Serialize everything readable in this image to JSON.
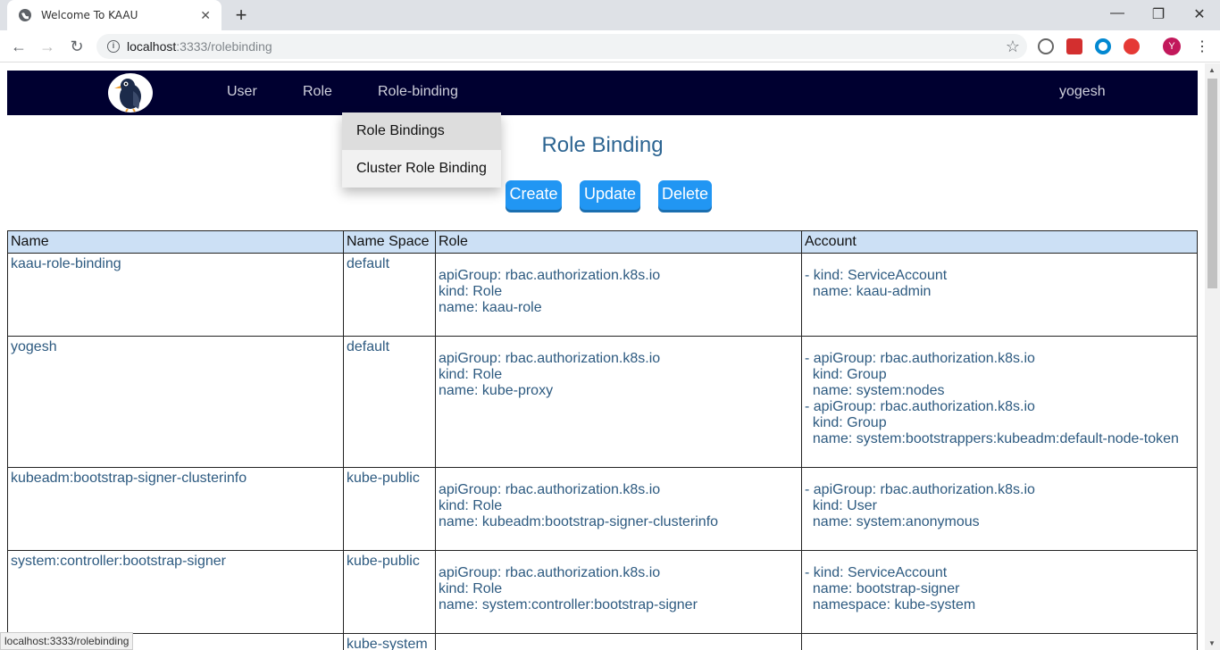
{
  "browser": {
    "tab_title": "Welcome To KAAU",
    "tab_close": "✕",
    "new_tab": "+",
    "url_host": "localhost",
    "url_rest": ":3333/rolebinding",
    "status_url": "localhost:3333/rolebinding",
    "avatar_letter": "Y"
  },
  "nav": {
    "links": [
      "User",
      "Role",
      "Role-binding"
    ],
    "user": "yogesh"
  },
  "dropdown": {
    "items": [
      "Role Bindings",
      "Cluster Role Binding"
    ]
  },
  "page": {
    "title": "Role Binding",
    "buttons": [
      "Create",
      "Update",
      "Delete"
    ]
  },
  "table": {
    "headers": [
      "Name",
      "Name Space",
      "Role",
      "Account"
    ],
    "rows": [
      {
        "name": "kaau-role-binding",
        "namespace": "default",
        "role": "apiGroup: rbac.authorization.k8s.io\nkind: Role\nname: kaau-role",
        "account": "- kind: ServiceAccount\n  name: kaau-admin"
      },
      {
        "name": "yogesh",
        "namespace": "default",
        "role": "apiGroup: rbac.authorization.k8s.io\nkind: Role\nname: kube-proxy",
        "account": "- apiGroup: rbac.authorization.k8s.io\n  kind: Group\n  name: system:nodes\n- apiGroup: rbac.authorization.k8s.io\n  kind: Group\n  name: system:bootstrappers:kubeadm:default-node-token"
      },
      {
        "name": "kubeadm:bootstrap-signer-clusterinfo",
        "namespace": "kube-public",
        "role": "apiGroup: rbac.authorization.k8s.io\nkind: Role\nname: kubeadm:bootstrap-signer-clusterinfo",
        "account": "- apiGroup: rbac.authorization.k8s.io\n  kind: User\n  name: system:anonymous"
      },
      {
        "name": "system:controller:bootstrap-signer",
        "namespace": "kube-public",
        "role": "apiGroup: rbac.authorization.k8s.io\nkind: Role\nname: system:controller:bootstrap-signer",
        "account": "- kind: ServiceAccount\n  name: bootstrap-signer\n  namespace: kube-system"
      },
      {
        "name": "",
        "namespace": "kube-system",
        "role": "",
        "account": ""
      }
    ]
  }
}
